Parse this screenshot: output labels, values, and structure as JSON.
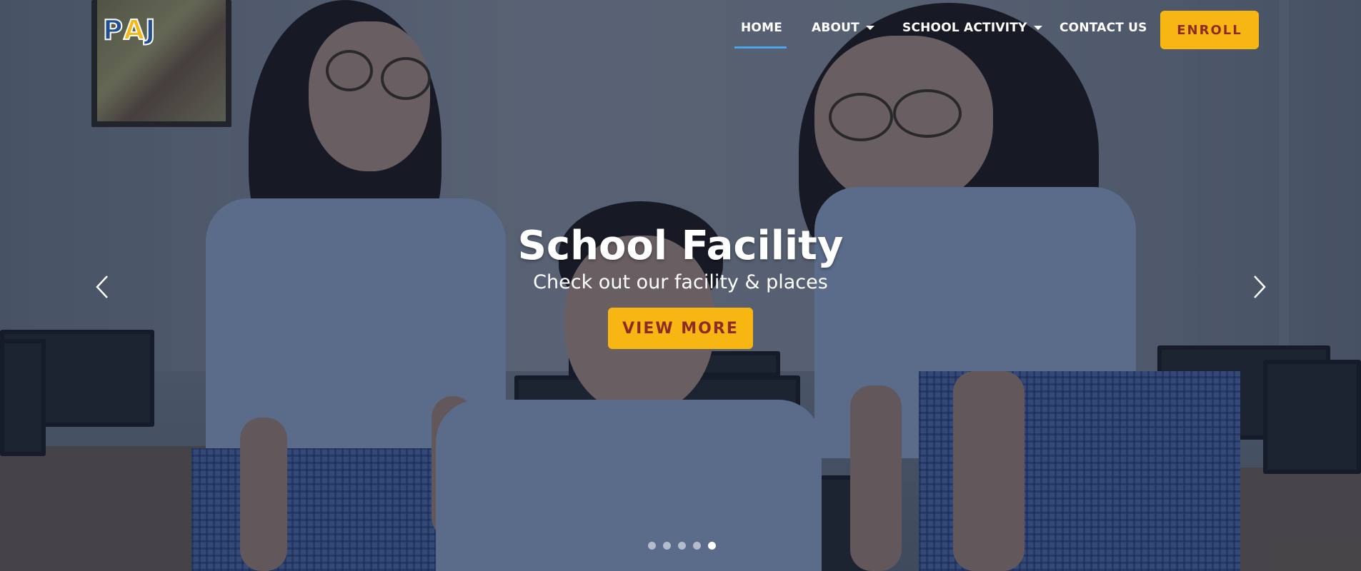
{
  "brand": {
    "logo_text": "PAJ",
    "logo_letters": [
      "P",
      "A",
      "J"
    ]
  },
  "nav": {
    "items": [
      {
        "label": "HOME",
        "active": true
      },
      {
        "label": "ABOUT",
        "dropdown": true
      },
      {
        "label": "SCHOOL ACTIVITY",
        "dropdown": true
      },
      {
        "label": "CONTACT US"
      }
    ],
    "enroll_label": "ENROLL"
  },
  "slide": {
    "title": "School Facility",
    "subtitle": "Check out our facility & places",
    "button_label": "VIEW MORE",
    "total_slides": 5,
    "active_slide": 5
  },
  "icons": {
    "prev": "chevron-left-icon",
    "next": "chevron-right-icon",
    "caret": "caret-down-icon"
  },
  "colors": {
    "accent": "#f7b611",
    "accent_text": "#8e2b25",
    "nav_active_underline": "#4aa6e8",
    "logo_blue": "#1f4f8f",
    "logo_yellow": "#f5b916"
  }
}
